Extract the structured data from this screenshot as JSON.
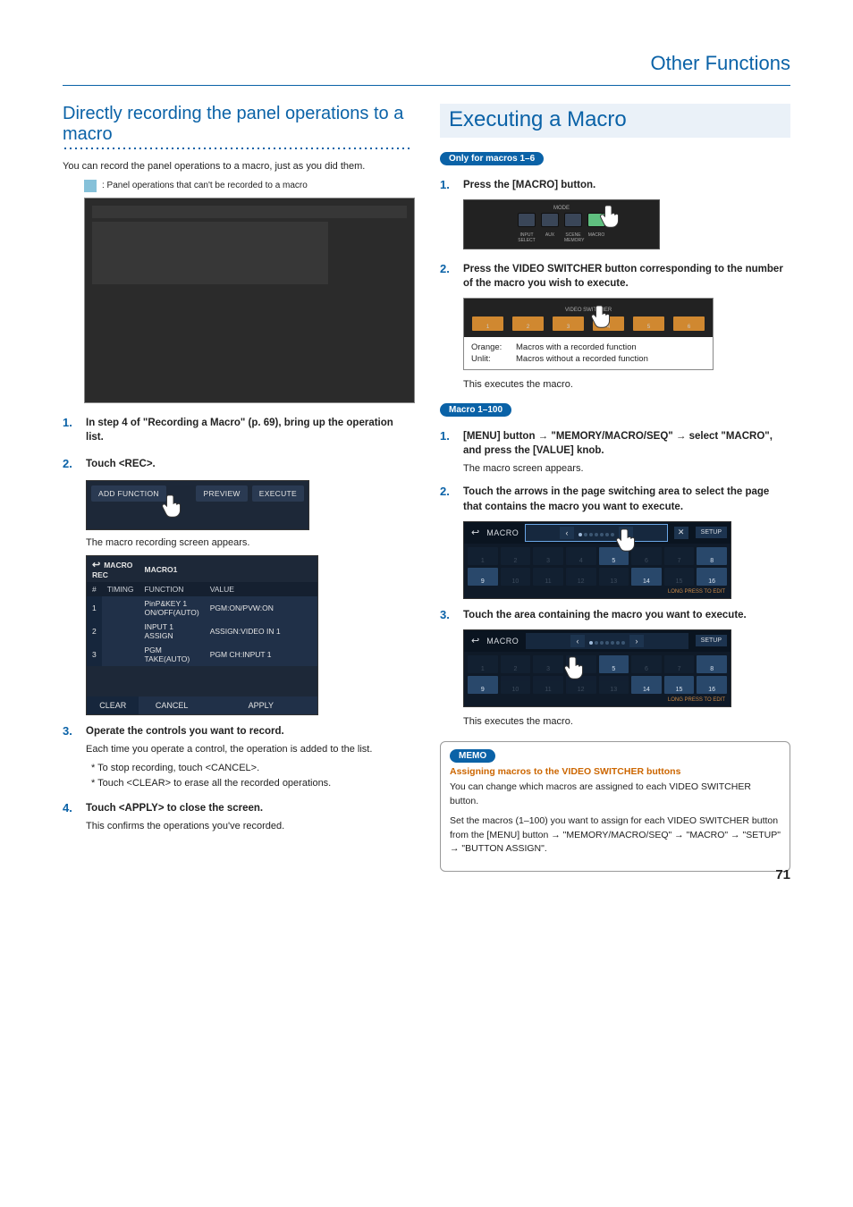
{
  "header": {
    "section": "Other Functions"
  },
  "page_number": "71",
  "left": {
    "title": "Directly recording the panel operations to a macro",
    "intro": "You can record the panel operations to a macro, just as you did them.",
    "legend": ": Panel operations that can't be recorded to a macro",
    "steps": {
      "s1": {
        "num": "1.",
        "title": "In step 4 of \"Recording a Macro\" (p. 69), bring up the operation list."
      },
      "s2": {
        "num": "2.",
        "title": "Touch <REC>.",
        "toolbar": {
          "add": "ADD FUNCTION",
          "preview": "PREVIEW",
          "execute": "EXECUTE"
        },
        "caption": "The macro recording screen appears.",
        "table": {
          "title_left": "MACRO REC",
          "title_right": "MACRO1",
          "cols": [
            "#",
            "TIMING",
            "FUNCTION",
            "VALUE"
          ],
          "rows": [
            {
              "n": "1",
              "t": "",
              "f": "PinP&KEY 1 ON/OFF(AUTO)",
              "v": "PGM:ON/PVW:ON"
            },
            {
              "n": "2",
              "t": "",
              "f": "INPUT 1 ASSIGN",
              "v": "ASSIGN:VIDEO IN 1"
            },
            {
              "n": "3",
              "t": "",
              "f": "PGM TAKE(AUTO)",
              "v": "PGM CH:INPUT 1"
            }
          ],
          "foot": [
            "CLEAR",
            "CANCEL",
            "APPLY"
          ]
        }
      },
      "s3": {
        "num": "3.",
        "title": "Operate the controls you want to record.",
        "sub": "Each time you operate a control, the operation is added to the list.",
        "b1": "*  To stop recording, touch <CANCEL>.",
        "b2": "*  Touch <CLEAR> to erase all the recorded operations."
      },
      "s4": {
        "num": "4.",
        "title": "Touch <APPLY> to close the screen.",
        "sub": "This confirms the operations you've recorded."
      }
    }
  },
  "right": {
    "title": "Executing a Macro",
    "sectA": {
      "pill": "Only for macros 1–6",
      "s1": {
        "num": "1.",
        "title": "Press the [MACRO] button.",
        "mode_title": "MODE",
        "mode_labels": [
          "INPUT SELECT",
          "AUX",
          "SCENE MEMORY",
          "MACRO"
        ]
      },
      "s2": {
        "num": "2.",
        "title": "Press the VIDEO SWITCHER button corresponding to the number of the macro you wish to execute.",
        "sw_group": "VIDEO SWITCHER",
        "sw_nums": [
          "1",
          "2",
          "3",
          "4",
          "5",
          "6"
        ],
        "cap_orange_l": "Orange:",
        "cap_orange_r": "Macros with a recorded function",
        "cap_unlit_l": "Unlit:",
        "cap_unlit_r": "Macros without a recorded function",
        "result": "This executes the macro."
      }
    },
    "sectB": {
      "pill": "Macro 1–100",
      "s1": {
        "num": "1.",
        "title_a": "[MENU] button ",
        "title_b": " \"MEMORY/MACRO/SEQ\" ",
        "title_c": " select \"MACRO\", and press the [VALUE] knob.",
        "sub": "The macro screen appears."
      },
      "s2": {
        "num": "2.",
        "title": "Touch the arrows in the page switching area to select the page that contains the macro you want to execute."
      },
      "s3": {
        "num": "3.",
        "title": "Touch the area containing the macro you want to execute.",
        "result": "This executes the macro."
      },
      "macro_ui": {
        "title": "MACRO",
        "setup": "SETUP",
        "foot": "LONG PRESS TO EDIT",
        "grid1": [
          "1",
          "2",
          "3",
          "4",
          "5",
          "6",
          "7",
          "8",
          "9",
          "10",
          "11",
          "12",
          "13",
          "14",
          "15",
          "16"
        ],
        "grid2": [
          "1",
          "2",
          "3",
          "4",
          "5",
          "6",
          "7",
          "8",
          "9",
          "10",
          "11",
          "12",
          "13",
          "14",
          "15",
          "16"
        ]
      }
    },
    "memo": {
      "pill": "MEMO",
      "subtitle": "Assigning macros to the VIDEO SWITCHER buttons",
      "p1": "You can change which macros are assigned to each VIDEO SWITCHER button.",
      "p2a": "Set the macros (1–100) you want to assign for each VIDEO SWITCHER button from the [MENU] button ",
      "p2b": " \"MEMORY/MACRO/SEQ\" ",
      "p2c": " \"MACRO\" ",
      "p2d": " \"SETUP\" ",
      "p2e": " \"BUTTON ASSIGN\"."
    }
  }
}
